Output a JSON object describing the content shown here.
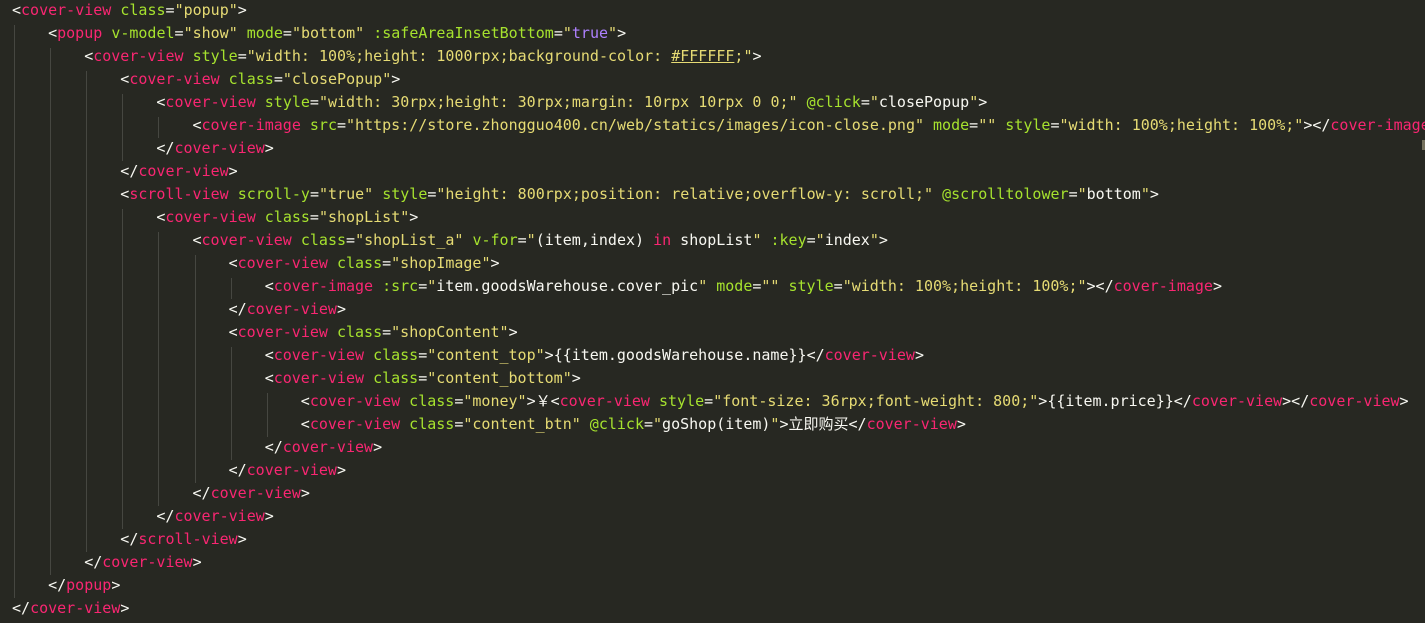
{
  "theme": {
    "background": "#272822",
    "punctuation": "#F8F8F2",
    "tag": "#F92672",
    "attribute": "#A6E22E",
    "string": "#E6DB74",
    "text": "#F8F8F2",
    "boolean": "#AE81FF",
    "keyword": "#F92672",
    "indent_guide": "#464741"
  },
  "lines": [
    {
      "indent": 0,
      "tokens": [
        [
          "p",
          "<"
        ],
        [
          "t",
          "cover-view"
        ],
        [
          "p",
          " "
        ],
        [
          "a",
          "class"
        ],
        [
          "p",
          "="
        ],
        [
          "s",
          "\"popup\""
        ],
        [
          "p",
          ">"
        ]
      ]
    },
    {
      "indent": 1,
      "tokens": [
        [
          "p",
          "<"
        ],
        [
          "t",
          "popup"
        ],
        [
          "p",
          " "
        ],
        [
          "a",
          "v-model"
        ],
        [
          "p",
          "="
        ],
        [
          "s",
          "\"show\""
        ],
        [
          "p",
          " "
        ],
        [
          "a",
          "mode"
        ],
        [
          "p",
          "="
        ],
        [
          "s",
          "\"bottom\""
        ],
        [
          "p",
          " "
        ],
        [
          "a",
          ":safeAreaInsetBottom"
        ],
        [
          "p",
          "="
        ],
        [
          "s",
          "\""
        ],
        [
          "b",
          "true"
        ],
        [
          "s",
          "\""
        ],
        [
          "p",
          ">"
        ]
      ]
    },
    {
      "indent": 2,
      "tokens": [
        [
          "p",
          "<"
        ],
        [
          "t",
          "cover-view"
        ],
        [
          "p",
          " "
        ],
        [
          "a",
          "style"
        ],
        [
          "p",
          "="
        ],
        [
          "s",
          "\"width: 100%;height: 1000rpx;background-color: "
        ],
        [
          "h",
          "#FFFFFF"
        ],
        [
          "s",
          ";\""
        ],
        [
          "p",
          ">"
        ]
      ]
    },
    {
      "indent": 3,
      "tokens": [
        [
          "p",
          "<"
        ],
        [
          "t",
          "cover-view"
        ],
        [
          "p",
          " "
        ],
        [
          "a",
          "class"
        ],
        [
          "p",
          "="
        ],
        [
          "s",
          "\"closePopup\""
        ],
        [
          "p",
          ">"
        ]
      ]
    },
    {
      "indent": 4,
      "tokens": [
        [
          "p",
          "<"
        ],
        [
          "t",
          "cover-view"
        ],
        [
          "p",
          " "
        ],
        [
          "a",
          "style"
        ],
        [
          "p",
          "="
        ],
        [
          "s",
          "\"width: 30rpx;height: 30rpx;margin: 10rpx 10rpx 0 0;\""
        ],
        [
          "p",
          " "
        ],
        [
          "a",
          "@click"
        ],
        [
          "p",
          "="
        ],
        [
          "s",
          "\""
        ],
        [
          "x",
          "closePopup"
        ],
        [
          "s",
          "\""
        ],
        [
          "p",
          ">"
        ]
      ]
    },
    {
      "indent": 5,
      "tokens": [
        [
          "p",
          "<"
        ],
        [
          "t",
          "cover-image"
        ],
        [
          "p",
          " "
        ],
        [
          "a",
          "src"
        ],
        [
          "p",
          "="
        ],
        [
          "s",
          "\"https://store.zhongguo400.cn/web/statics/images/icon-close.png\""
        ],
        [
          "p",
          " "
        ],
        [
          "a",
          "mode"
        ],
        [
          "p",
          "="
        ],
        [
          "s",
          "\"\""
        ],
        [
          "p",
          " "
        ],
        [
          "a",
          "style"
        ],
        [
          "p",
          "="
        ],
        [
          "s",
          "\"width: 100%;height: 100%;\""
        ],
        [
          "p",
          "></"
        ],
        [
          "t",
          "cover-image"
        ]
      ]
    },
    {
      "indent": 4,
      "tokens": [
        [
          "p",
          "</"
        ],
        [
          "t",
          "cover-view"
        ],
        [
          "p",
          ">"
        ]
      ]
    },
    {
      "indent": 3,
      "tokens": [
        [
          "p",
          "</"
        ],
        [
          "t",
          "cover-view"
        ],
        [
          "p",
          ">"
        ]
      ]
    },
    {
      "indent": 3,
      "tokens": [
        [
          "p",
          "<"
        ],
        [
          "t",
          "scroll-view"
        ],
        [
          "p",
          " "
        ],
        [
          "a",
          "scroll-y"
        ],
        [
          "p",
          "="
        ],
        [
          "s",
          "\"true\""
        ],
        [
          "p",
          " "
        ],
        [
          "a",
          "style"
        ],
        [
          "p",
          "="
        ],
        [
          "s",
          "\"height: 800rpx;position: relative;overflow-y: scroll;\""
        ],
        [
          "p",
          " "
        ],
        [
          "a",
          "@scrolltolower"
        ],
        [
          "p",
          "="
        ],
        [
          "s",
          "\""
        ],
        [
          "x",
          "bottom"
        ],
        [
          "s",
          "\""
        ],
        [
          "p",
          ">"
        ]
      ]
    },
    {
      "indent": 4,
      "tokens": [
        [
          "p",
          "<"
        ],
        [
          "t",
          "cover-view"
        ],
        [
          "p",
          " "
        ],
        [
          "a",
          "class"
        ],
        [
          "p",
          "="
        ],
        [
          "s",
          "\"shopList\""
        ],
        [
          "p",
          ">"
        ]
      ]
    },
    {
      "indent": 5,
      "tokens": [
        [
          "p",
          "<"
        ],
        [
          "t",
          "cover-view"
        ],
        [
          "p",
          " "
        ],
        [
          "a",
          "class"
        ],
        [
          "p",
          "="
        ],
        [
          "s",
          "\"shopList_a\""
        ],
        [
          "p",
          " "
        ],
        [
          "a",
          "v-for"
        ],
        [
          "p",
          "="
        ],
        [
          "s",
          "\""
        ],
        [
          "x",
          "(item,index) "
        ],
        [
          "k",
          "in"
        ],
        [
          "x",
          " shopList"
        ],
        [
          "s",
          "\""
        ],
        [
          "p",
          " "
        ],
        [
          "a",
          ":key"
        ],
        [
          "p",
          "="
        ],
        [
          "s",
          "\""
        ],
        [
          "x",
          "index"
        ],
        [
          "s",
          "\""
        ],
        [
          "p",
          ">"
        ]
      ]
    },
    {
      "indent": 6,
      "tokens": [
        [
          "p",
          "<"
        ],
        [
          "t",
          "cover-view"
        ],
        [
          "p",
          " "
        ],
        [
          "a",
          "class"
        ],
        [
          "p",
          "="
        ],
        [
          "s",
          "\"shopImage\""
        ],
        [
          "p",
          ">"
        ]
      ]
    },
    {
      "indent": 7,
      "tokens": [
        [
          "p",
          "<"
        ],
        [
          "t",
          "cover-image"
        ],
        [
          "p",
          " "
        ],
        [
          "a",
          ":src"
        ],
        [
          "p",
          "="
        ],
        [
          "s",
          "\""
        ],
        [
          "x",
          "item.goodsWarehouse.cover_pic"
        ],
        [
          "s",
          "\""
        ],
        [
          "p",
          " "
        ],
        [
          "a",
          "mode"
        ],
        [
          "p",
          "="
        ],
        [
          "s",
          "\"\""
        ],
        [
          "p",
          " "
        ],
        [
          "a",
          "style"
        ],
        [
          "p",
          "="
        ],
        [
          "s",
          "\"width: 100%;height: 100%;\""
        ],
        [
          "p",
          "></"
        ],
        [
          "t",
          "cover-image"
        ],
        [
          "p",
          ">"
        ]
      ]
    },
    {
      "indent": 6,
      "tokens": [
        [
          "p",
          "</"
        ],
        [
          "t",
          "cover-view"
        ],
        [
          "p",
          ">"
        ]
      ]
    },
    {
      "indent": 6,
      "tokens": [
        [
          "p",
          "<"
        ],
        [
          "t",
          "cover-view"
        ],
        [
          "p",
          " "
        ],
        [
          "a",
          "class"
        ],
        [
          "p",
          "="
        ],
        [
          "s",
          "\"shopContent\""
        ],
        [
          "p",
          ">"
        ]
      ]
    },
    {
      "indent": 7,
      "tokens": [
        [
          "p",
          "<"
        ],
        [
          "t",
          "cover-view"
        ],
        [
          "p",
          " "
        ],
        [
          "a",
          "class"
        ],
        [
          "p",
          "="
        ],
        [
          "s",
          "\"content_top\""
        ],
        [
          "p",
          ">"
        ],
        [
          "x",
          "{{item.goodsWarehouse.name}}"
        ],
        [
          "p",
          "</"
        ],
        [
          "t",
          "cover-view"
        ],
        [
          "p",
          ">"
        ]
      ]
    },
    {
      "indent": 7,
      "tokens": [
        [
          "p",
          "<"
        ],
        [
          "t",
          "cover-view"
        ],
        [
          "p",
          " "
        ],
        [
          "a",
          "class"
        ],
        [
          "p",
          "="
        ],
        [
          "s",
          "\"content_bottom\""
        ],
        [
          "p",
          ">"
        ]
      ]
    },
    {
      "indent": 8,
      "tokens": [
        [
          "p",
          "<"
        ],
        [
          "t",
          "cover-view"
        ],
        [
          "p",
          " "
        ],
        [
          "a",
          "class"
        ],
        [
          "p",
          "="
        ],
        [
          "s",
          "\"money\""
        ],
        [
          "p",
          ">"
        ],
        [
          "x",
          "￥"
        ],
        [
          "p",
          "<"
        ],
        [
          "t",
          "cover-view"
        ],
        [
          "p",
          " "
        ],
        [
          "a",
          "style"
        ],
        [
          "p",
          "="
        ],
        [
          "s",
          "\"font-size: 36rpx;font-weight: 800;\""
        ],
        [
          "p",
          ">"
        ],
        [
          "x",
          "{{item.price}}"
        ],
        [
          "p",
          "</"
        ],
        [
          "t",
          "cover-view"
        ],
        [
          "p",
          "></"
        ],
        [
          "t",
          "cover-view"
        ],
        [
          "p",
          ">"
        ]
      ]
    },
    {
      "indent": 8,
      "tokens": [
        [
          "p",
          "<"
        ],
        [
          "t",
          "cover-view"
        ],
        [
          "p",
          " "
        ],
        [
          "a",
          "class"
        ],
        [
          "p",
          "="
        ],
        [
          "s",
          "\"content_btn\""
        ],
        [
          "p",
          " "
        ],
        [
          "a",
          "@click"
        ],
        [
          "p",
          "="
        ],
        [
          "s",
          "\""
        ],
        [
          "x",
          "goShop(item)"
        ],
        [
          "s",
          "\""
        ],
        [
          "p",
          ">"
        ],
        [
          "x",
          "立即购买"
        ],
        [
          "p",
          "</"
        ],
        [
          "t",
          "cover-view"
        ],
        [
          "p",
          ">"
        ]
      ]
    },
    {
      "indent": 7,
      "tokens": [
        [
          "p",
          "</"
        ],
        [
          "t",
          "cover-view"
        ],
        [
          "p",
          ">"
        ]
      ]
    },
    {
      "indent": 6,
      "tokens": [
        [
          "p",
          "</"
        ],
        [
          "t",
          "cover-view"
        ],
        [
          "p",
          ">"
        ]
      ]
    },
    {
      "indent": 5,
      "tokens": [
        [
          "p",
          "</"
        ],
        [
          "t",
          "cover-view"
        ],
        [
          "p",
          ">"
        ]
      ]
    },
    {
      "indent": 4,
      "tokens": [
        [
          "p",
          "</"
        ],
        [
          "t",
          "cover-view"
        ],
        [
          "p",
          ">"
        ]
      ]
    },
    {
      "indent": 3,
      "tokens": [
        [
          "p",
          "</"
        ],
        [
          "t",
          "scroll-view"
        ],
        [
          "p",
          ">"
        ]
      ]
    },
    {
      "indent": 2,
      "tokens": [
        [
          "p",
          "</"
        ],
        [
          "t",
          "cover-view"
        ],
        [
          "p",
          ">"
        ]
      ]
    },
    {
      "indent": 1,
      "tokens": [
        [
          "p",
          "</"
        ],
        [
          "t",
          "popup"
        ],
        [
          "p",
          ">"
        ]
      ]
    },
    {
      "indent": 0,
      "tokens": [
        [
          "p",
          "</"
        ],
        [
          "t",
          "cover-view"
        ],
        [
          "p",
          ">"
        ]
      ]
    }
  ]
}
